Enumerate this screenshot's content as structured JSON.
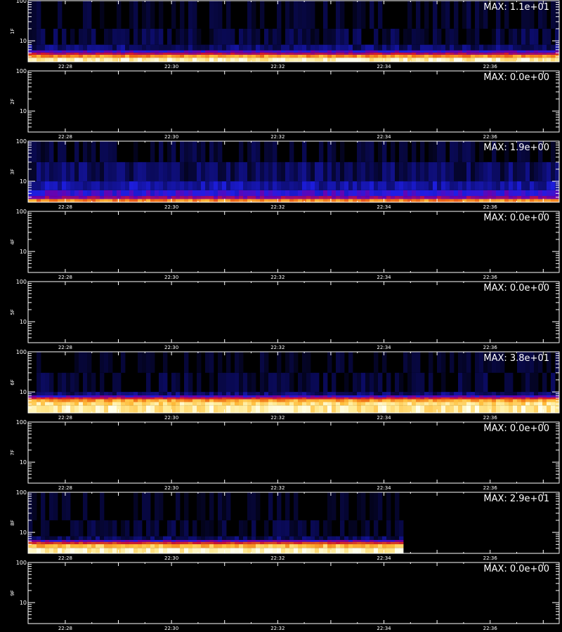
{
  "footer_text": "",
  "chart_data": [
    {
      "type": "heatmap",
      "panel_label": "1F",
      "max_label": "MAX: 1.1e+01",
      "y_ticks": [
        "100",
        "10"
      ],
      "ylim": [
        3,
        100
      ],
      "y_scale": "log",
      "x_ticks": [
        "22:28",
        "22:30",
        "22:32",
        "22:34",
        "22:36"
      ],
      "bands": [
        {
          "ymin": 3,
          "ymax": 3.8,
          "level": 0.95
        },
        {
          "ymin": 3.8,
          "ymax": 4.5,
          "level": 0.72
        },
        {
          "ymin": 4.5,
          "ymax": 5.1,
          "level": 0.45
        },
        {
          "ymin": 5.1,
          "ymax": 5.8,
          "level": 0.3
        },
        {
          "ymin": 5.8,
          "ymax": 8,
          "level": 0.12
        },
        {
          "ymin": 8,
          "ymax": 20,
          "level": 0.06
        },
        {
          "ymin": 20,
          "ymax": 100,
          "level": 0.025
        }
      ],
      "data_end_fraction": 1.0
    },
    {
      "type": "heatmap",
      "panel_label": "2F",
      "max_label": "MAX: 0.0e+00",
      "y_ticks": [
        "100",
        "10"
      ],
      "ylim": [
        3,
        100
      ],
      "y_scale": "log",
      "x_ticks": [
        "22:28",
        "22:30",
        "22:32",
        "22:34",
        "22:36"
      ],
      "bands": [],
      "data_end_fraction": 1.0
    },
    {
      "type": "heatmap",
      "panel_label": "3F",
      "max_label": "MAX: 1.9e+00",
      "y_ticks": [
        "100",
        "10"
      ],
      "ylim": [
        3,
        100
      ],
      "y_scale": "log",
      "x_ticks": [
        "22:28",
        "22:30",
        "22:32",
        "22:34",
        "22:36"
      ],
      "bands": [
        {
          "ymin": 3,
          "ymax": 3.6,
          "level": 0.7
        },
        {
          "ymin": 3.6,
          "ymax": 4.3,
          "level": 0.4
        },
        {
          "ymin": 4.3,
          "ymax": 6,
          "level": 0.28
        },
        {
          "ymin": 6,
          "ymax": 10,
          "level": 0.18
        },
        {
          "ymin": 10,
          "ymax": 30,
          "level": 0.1
        },
        {
          "ymin": 30,
          "ymax": 100,
          "level": 0.04
        }
      ],
      "data_end_fraction": 1.0
    },
    {
      "type": "heatmap",
      "panel_label": "4F",
      "max_label": "MAX: 0.0e+00",
      "y_ticks": [
        "100",
        "10"
      ],
      "ylim": [
        3,
        100
      ],
      "y_scale": "log",
      "x_ticks": [
        "22:28",
        "22:30",
        "22:32",
        "22:34",
        "22:36"
      ],
      "bands": [],
      "data_end_fraction": 1.0
    },
    {
      "type": "heatmap",
      "panel_label": "5F",
      "max_label": "MAX: 0.0e+00",
      "y_ticks": [
        "100",
        "10"
      ],
      "ylim": [
        3,
        100
      ],
      "y_scale": "log",
      "x_ticks": [
        "22:28",
        "22:30",
        "22:32",
        "22:34",
        "22:36"
      ],
      "bands": [],
      "data_end_fraction": 1.0
    },
    {
      "type": "heatmap",
      "panel_label": "6F",
      "max_label": "MAX: 3.8e+01",
      "y_ticks": [
        "100",
        "10"
      ],
      "ylim": [
        3,
        100
      ],
      "y_scale": "log",
      "x_ticks": [
        "22:28",
        "22:30",
        "22:32",
        "22:34",
        "22:36"
      ],
      "bands": [
        {
          "ymin": 3,
          "ymax": 4.6,
          "level": 0.93
        },
        {
          "ymin": 4.6,
          "ymax": 5.6,
          "level": 0.88
        },
        {
          "ymin": 5.6,
          "ymax": 6.6,
          "level": 0.75
        },
        {
          "ymin": 6.6,
          "ymax": 7.3,
          "level": 0.5
        },
        {
          "ymin": 7.3,
          "ymax": 8.2,
          "level": 0.32
        },
        {
          "ymin": 8.2,
          "ymax": 10,
          "level": 0.12
        },
        {
          "ymin": 10,
          "ymax": 30,
          "level": 0.05
        },
        {
          "ymin": 30,
          "ymax": 100,
          "level": 0.02
        }
      ],
      "data_end_fraction": 1.0
    },
    {
      "type": "heatmap",
      "panel_label": "7F",
      "max_label": "MAX: 0.0e+00",
      "y_ticks": [
        "100",
        "10"
      ],
      "ylim": [
        3,
        100
      ],
      "y_scale": "log",
      "x_ticks": [
        "22:28",
        "22:30",
        "22:32",
        "22:34",
        "22:36"
      ],
      "bands": [],
      "data_end_fraction": 1.0
    },
    {
      "type": "heatmap",
      "panel_label": "8F",
      "max_label": "MAX: 2.9e+01",
      "y_ticks": [
        "100",
        "10"
      ],
      "ylim": [
        3,
        100
      ],
      "y_scale": "log",
      "x_ticks": [
        "22:28",
        "22:30",
        "22:32",
        "22:34",
        "22:36"
      ],
      "bands": [
        {
          "ymin": 3,
          "ymax": 4.1,
          "level": 0.96
        },
        {
          "ymin": 4.1,
          "ymax": 5.1,
          "level": 0.8
        },
        {
          "ymin": 5.1,
          "ymax": 5.8,
          "level": 0.55
        },
        {
          "ymin": 5.8,
          "ymax": 6.5,
          "level": 0.32
        },
        {
          "ymin": 6.5,
          "ymax": 8,
          "level": 0.1
        },
        {
          "ymin": 8,
          "ymax": 20,
          "level": 0.04
        },
        {
          "ymin": 20,
          "ymax": 100,
          "level": 0.015
        }
      ],
      "data_end_fraction": 0.71
    },
    {
      "type": "heatmap",
      "panel_label": "9F",
      "max_label": "MAX: 0.0e+00",
      "y_ticks": [
        "100",
        "10"
      ],
      "ylim": [
        3,
        100
      ],
      "y_scale": "log",
      "x_ticks": [
        "22:28",
        "22:30",
        "22:32",
        "22:34",
        "22:36"
      ],
      "bands": [],
      "data_end_fraction": 1.0
    }
  ]
}
